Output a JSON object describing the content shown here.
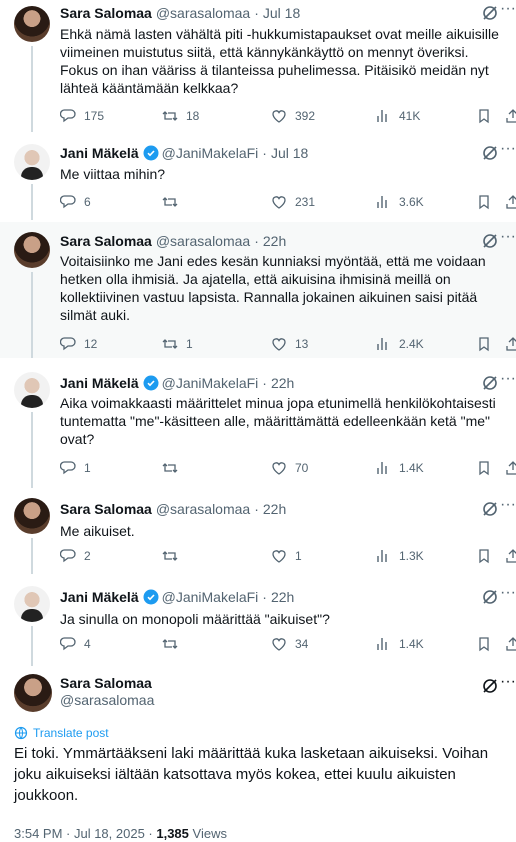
{
  "tweets": [
    {
      "name": "Sara Salomaa",
      "handle": "@sarasalomaa",
      "date": "Jul 18",
      "text": "Ehkä nämä lasten vähältä piti -hukkumistapaukset ovat meille aikuisille viimeinen muistutus siitä, että kännykänkäyttö on mennyt överiksi. Fokus on ihan vääriss ä tilanteissa puhelimessa. Pitäisikö meidän nyt lähteä kääntämään kelkkaa?",
      "replies": "175",
      "retweets": "18",
      "likes": "392",
      "views": "41K"
    },
    {
      "name": "Jani Mäkelä",
      "handle": "@JaniMakelaFi",
      "date": "Jul 18",
      "text": "Me viittaa mihin?",
      "replies": "6",
      "retweets": "",
      "likes": "231",
      "views": "3.6K"
    },
    {
      "name": "Sara Salomaa",
      "handle": "@sarasalomaa",
      "date": "22h",
      "text": "Voitaisiinko me Jani edes kesän kunniaksi myöntää, että me voidaan hetken olla ihmisiä. Ja ajatella, että aikuisina ihmisinä meillä on kollektiivinen vastuu lapsista. Rannalla jokainen aikuinen saisi pitää silmät auki.",
      "replies": "12",
      "retweets": "1",
      "likes": "13",
      "views": "2.4K"
    },
    {
      "name": "Jani Mäkelä",
      "handle": "@JaniMakelaFi",
      "date": "22h",
      "text": "Aika voimakkaasti määrittelet minua jopa etunimellä henkilökohtaisesti tuntematta \"me\"-käsitteen alle, määrittämättä edelleenkään ketä \"me\" ovat?",
      "replies": "1",
      "retweets": "",
      "likes": "70",
      "views": "1.4K"
    },
    {
      "name": "Sara Salomaa",
      "handle": "@sarasalomaa",
      "date": "22h",
      "text": "Me aikuiset.",
      "replies": "2",
      "retweets": "",
      "likes": "1",
      "views": "1.3K"
    },
    {
      "name": "Jani Mäkelä",
      "handle": "@JaniMakelaFi",
      "date": "22h",
      "text": "Ja sinulla on monopoli määrittää \"aikuiset\"?",
      "replies": "4",
      "retweets": "",
      "likes": "34",
      "views": "1.4K"
    }
  ],
  "main": {
    "name": "Sara Salomaa",
    "handle": "@sarasalomaa",
    "translate": "Translate post",
    "text": "Ei toki. Ymmärtääkseni laki määrittää kuka lasketaan aikuiseksi. Voihan joku aikuiseksi iältään katsottava myös kokea, ettei kuulu aikuisten joukkoon.",
    "time": "3:54 PM · Jul 18, 2025 · ",
    "views_count": "1,385",
    "views_label": " Views"
  },
  "colors": {
    "accent": "#1d9bf0",
    "secondary": "#536471",
    "line": "#cfd9de"
  },
  "icons": [
    "reply-icon",
    "retweet-icon",
    "like-icon",
    "views-icon",
    "bookmark-icon",
    "share-icon",
    "grok-icon",
    "more-icon",
    "verified-icon",
    "translate-icon"
  ]
}
